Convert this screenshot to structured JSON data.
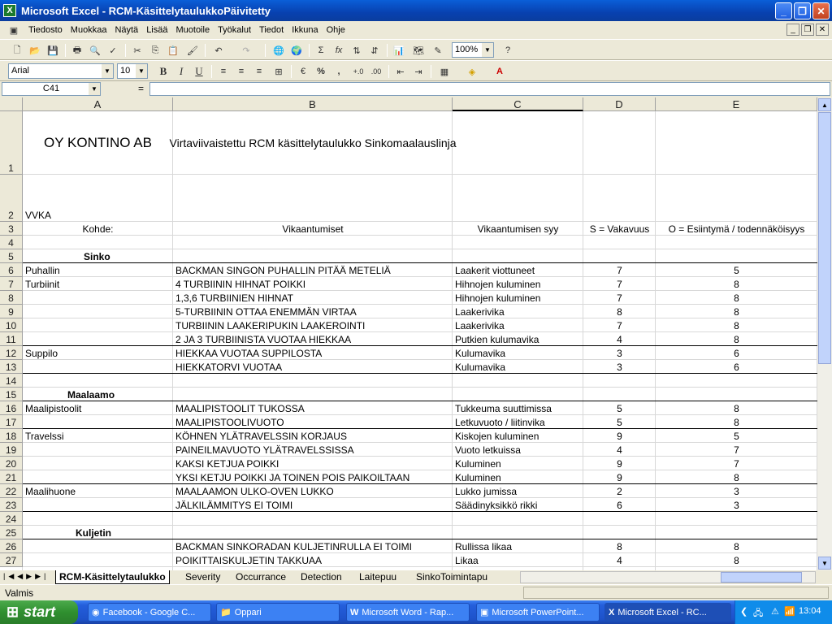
{
  "window": {
    "title": "Microsoft Excel - RCM-KäsittelytaulukkoPäivitetty"
  },
  "menu": [
    "Tiedosto",
    "Muokkaa",
    "Näytä",
    "Lisää",
    "Muotoile",
    "Työkalut",
    "Tiedot",
    "Ikkuna",
    "Ohje"
  ],
  "toolbar": {
    "zoom": "100%",
    "font": "Arial",
    "size": "10",
    "bold": "B",
    "italic": "I",
    "underline": "U",
    "sum": "Σ",
    "fx": "fx",
    "percent": "%",
    "comma": ","
  },
  "formula": {
    "namebox": "C41",
    "equals": "=",
    "value": ""
  },
  "columns": [
    "A",
    "B",
    "C",
    "D",
    "E"
  ],
  "rows": [
    {
      "n": "1",
      "a": "OY KONTINO AB",
      "b": "Virtaviivaistettu RCM käsittelytaulukko Sinkomaalauslinja",
      "c": "",
      "d": "",
      "e": ""
    },
    {
      "n": "2",
      "a": "VVKA",
      "b": "",
      "c": "",
      "d": "",
      "e": ""
    },
    {
      "n": "3",
      "a": "Kohde:",
      "b": "Vikaantumiset",
      "c": "Vikaantumisen syy",
      "d": "S = Vakavuus",
      "e": "O = Esiintymä / todennäköisyys"
    },
    {
      "n": "4",
      "a": "",
      "b": "",
      "c": "",
      "d": "",
      "e": ""
    },
    {
      "n": "5",
      "a": "Sinko",
      "b": "",
      "c": "",
      "d": "",
      "e": ""
    },
    {
      "n": "6",
      "a": "Puhallin",
      "b": "BACKMAN SINGON PUHALLIN PITÄÄ METELIÄ",
      "c": "Laakerit viottuneet",
      "d": "7",
      "e": "5"
    },
    {
      "n": "7",
      "a": "Turbiinit",
      "b": "4 TURBIININ HIHNAT POIKKI",
      "c": "Hihnojen kuluminen",
      "d": "7",
      "e": "8"
    },
    {
      "n": "8",
      "a": "",
      "b": "1,3,6 TURBIINIEN HIHNAT",
      "c": "Hihnojen kuluminen",
      "d": "7",
      "e": "8"
    },
    {
      "n": "9",
      "a": "",
      "b": "5-TURBIININ OTTAA ENEMMÄN VIRTAA",
      "c": "Laakerivika",
      "d": "8",
      "e": "8"
    },
    {
      "n": "10",
      "a": "",
      "b": "TURBIININ LAAKERIPUKIN LAAKEROINTI",
      "c": "Laakerivika",
      "d": "7",
      "e": "8"
    },
    {
      "n": "11",
      "a": "",
      "b": "2 JA 3 TURBIINISTA VUOTAA HIEKKAA",
      "c": "Putkien kulumavika",
      "d": "4",
      "e": "8"
    },
    {
      "n": "12",
      "a": "Suppilo",
      "b": "HIEKKAA VUOTAA SUPPILOSTA",
      "c": "Kulumavika",
      "d": "3",
      "e": "6"
    },
    {
      "n": "13",
      "a": "",
      "b": "HIEKKATORVI VUOTAA",
      "c": "Kulumavika",
      "d": "3",
      "e": "6"
    },
    {
      "n": "14",
      "a": "",
      "b": "",
      "c": "",
      "d": "",
      "e": ""
    },
    {
      "n": "15",
      "a": "Maalaamo",
      "b": "",
      "c": "",
      "d": "",
      "e": ""
    },
    {
      "n": "16",
      "a": "Maalipistoolit",
      "b": "MAALIPISTOOLIT TUKOSSA",
      "c": "Tukkeuma suuttimissa",
      "d": "5",
      "e": "8"
    },
    {
      "n": "17",
      "a": "",
      "b": "MAALIPISTOOLIVUOTO",
      "c": "Letkuvuoto / liitinvika",
      "d": "5",
      "e": "8"
    },
    {
      "n": "18",
      "a": "Travelssi",
      "b": "KÖHNEN YLÄTRAVELSSIN KORJAUS",
      "c": "Kiskojen kuluminen",
      "d": "9",
      "e": "5"
    },
    {
      "n": "19",
      "a": "",
      "b": "PAINEILMAVUOTO YLÄTRAVELSSISSA",
      "c": "Vuoto letkuissa",
      "d": "4",
      "e": "7"
    },
    {
      "n": "20",
      "a": "",
      "b": "KAKSI KETJUA POIKKI",
      "c": "Kuluminen",
      "d": "9",
      "e": "7"
    },
    {
      "n": "21",
      "a": "",
      "b": "YKSI KETJU POIKKI JA TOINEN POIS PAIKOILTAAN",
      "c": "Kuluminen",
      "d": "9",
      "e": "8"
    },
    {
      "n": "22",
      "a": "Maalihuone",
      "b": "MAALAAMON ULKO-OVEN LUKKO",
      "c": "Lukko jumissa",
      "d": "2",
      "e": "3"
    },
    {
      "n": "23",
      "a": "",
      "b": "JÄLKILÄMMITYS EI TOIMI",
      "c": "Säädinyksikkö rikki",
      "d": "6",
      "e": "3"
    },
    {
      "n": "24",
      "a": "",
      "b": "",
      "c": "",
      "d": "",
      "e": ""
    },
    {
      "n": "25",
      "a": "Kuljetin",
      "b": "",
      "c": "",
      "d": "",
      "e": ""
    },
    {
      "n": "26",
      "a": "",
      "b": "BACKMAN SINKORADAN KULJETINRULLA EI TOIMI",
      "c": "Rullissa likaa",
      "d": "8",
      "e": "8"
    },
    {
      "n": "27",
      "a": "",
      "b": "POIKITTAISKULJETIN TAKKUAA",
      "c": "Likaa",
      "d": "4",
      "e": "8"
    }
  ],
  "tabs": [
    "RCM-Käsittelytaulukko",
    "Severity",
    "Occurrance",
    "Detection",
    "Laitepuu",
    "SinkoToimintapu"
  ],
  "status": {
    "text": "Valmis"
  },
  "taskbar": {
    "start": "start",
    "items": [
      "Facebook - Google C...",
      "Oppari",
      "Microsoft Word - Rap...",
      "Microsoft PowerPoint...",
      "Microsoft Excel - RC..."
    ],
    "time": "13:04"
  },
  "colors": {
    "titlebar": "#0a4fcf",
    "taskbar": "#245edb",
    "start": "#2f8f2f"
  }
}
